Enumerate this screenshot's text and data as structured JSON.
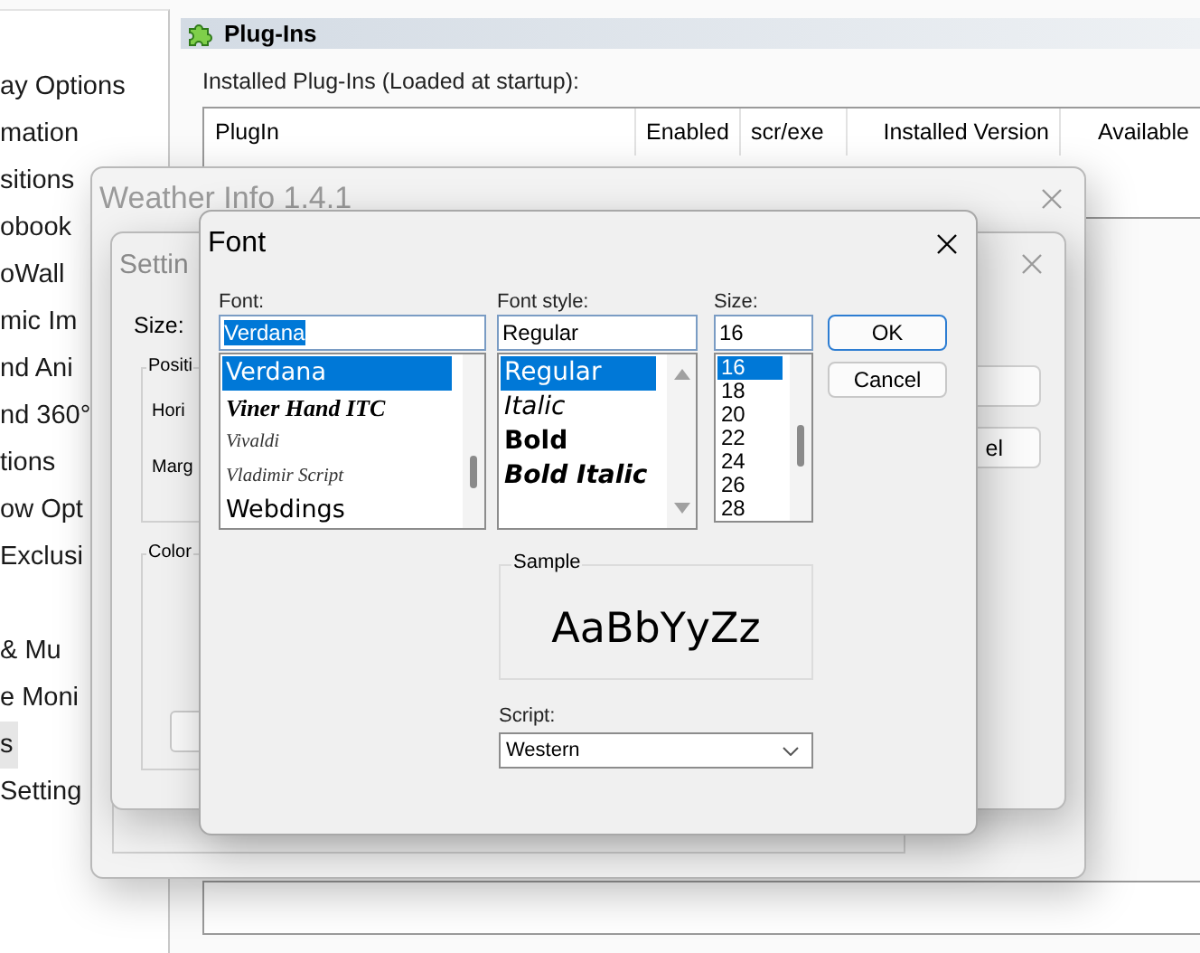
{
  "sidebar": {
    "groups": [
      {
        "items": [
          {
            "label": "ay Options",
            "selected": false
          },
          {
            "label": "mation",
            "selected": false
          },
          {
            "label": "sitions",
            "selected": false
          },
          {
            "label": "obook",
            "selected": false
          },
          {
            "label": "oWall",
            "selected": false
          },
          {
            "label": "mic Im",
            "selected": false
          },
          {
            "label": "nd Ani",
            "selected": false
          },
          {
            "label": "nd 360°",
            "selected": false
          },
          {
            "label": "tions",
            "selected": false
          },
          {
            "label": "ow Opt",
            "selected": false
          },
          {
            "label": "Exclusi",
            "selected": false
          }
        ]
      },
      {
        "items": [
          {
            "label": "& Mu",
            "selected": false
          },
          {
            "label": "e Moni",
            "selected": false
          },
          {
            "label": "s",
            "selected": true
          },
          {
            "label": "Setting",
            "selected": false
          }
        ]
      }
    ]
  },
  "plugins_panel": {
    "title": "Plug-Ins",
    "caption": "Installed Plug-Ins (Loaded at startup):",
    "table": {
      "columns": [
        "PlugIn",
        "Enabled",
        "scr/exe",
        "Installed Version",
        "Available"
      ]
    }
  },
  "weather_window": {
    "title": "Weather Info 1.4.1",
    "active": false
  },
  "settings_window": {
    "title": "Settin",
    "active": false,
    "size_label": "Size:",
    "position_group": "Positi",
    "horizontal_label": "Hori",
    "margin_label": "Marg",
    "color_group": "Color",
    "button_fragment": "el"
  },
  "font_dialog": {
    "title": "Font",
    "font": {
      "label": "Font:",
      "value": "Verdana",
      "items": [
        {
          "label": "Verdana",
          "kind": "sans",
          "selected": true
        },
        {
          "label": "Viner Hand ITC",
          "kind": "script",
          "selected": false
        },
        {
          "label": "Vivaldi",
          "kind": "fancy",
          "selected": false
        },
        {
          "label": "Vladimir Script",
          "kind": "fancy",
          "selected": false
        },
        {
          "label": "Webdings",
          "kind": "sans",
          "selected": false
        }
      ]
    },
    "style": {
      "label": "Font style:",
      "value": "Regular",
      "items": [
        {
          "label": "Regular",
          "kind": "regular",
          "selected": true
        },
        {
          "label": "Italic",
          "kind": "italic",
          "selected": false
        },
        {
          "label": "Bold",
          "kind": "bold",
          "selected": false
        },
        {
          "label": "Bold Italic",
          "kind": "bold-italic",
          "selected": false
        }
      ]
    },
    "size": {
      "label": "Size:",
      "value": "16",
      "items": [
        {
          "label": "16",
          "selected": true
        },
        {
          "label": "18",
          "selected": false
        },
        {
          "label": "20",
          "selected": false
        },
        {
          "label": "22",
          "selected": false
        },
        {
          "label": "24",
          "selected": false
        },
        {
          "label": "26",
          "selected": false
        },
        {
          "label": "28",
          "selected": false
        }
      ]
    },
    "buttons": [
      {
        "label": "OK",
        "default": true
      },
      {
        "label": "Cancel",
        "default": false
      }
    ],
    "sample": {
      "label": "Sample",
      "text": "AaBbYyZz"
    },
    "script": {
      "label": "Script:",
      "value": "Western"
    }
  }
}
